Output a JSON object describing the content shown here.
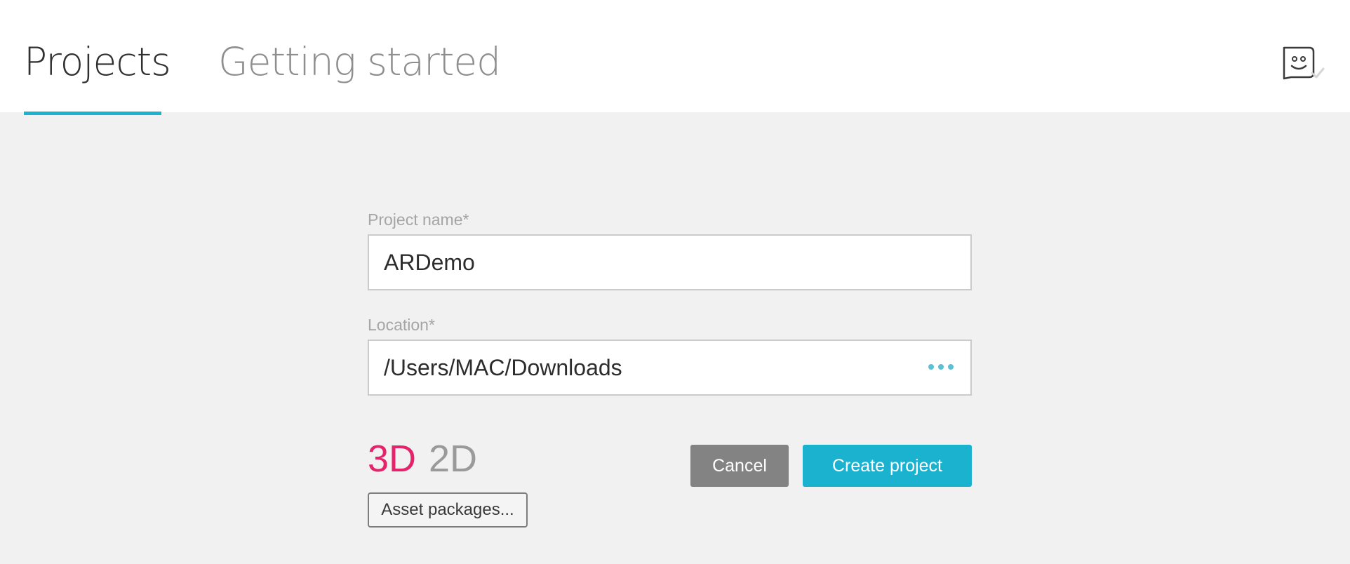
{
  "header": {
    "tabs": [
      {
        "label": "Projects",
        "active": true
      },
      {
        "label": "Getting started",
        "active": false
      }
    ],
    "account_icon": "account-smiley-icon",
    "accent_color": "#1ab2cf"
  },
  "form": {
    "project_name": {
      "label": "Project name*",
      "value": "ARDemo"
    },
    "location": {
      "label": "Location*",
      "value": "/Users/MAC/Downloads",
      "browse_icon": "more-dots-icon"
    },
    "modes": [
      {
        "label": "3D",
        "selected": true,
        "color": "#e5226a"
      },
      {
        "label": "2D",
        "selected": false,
        "color": "#9a9a9a"
      }
    ],
    "asset_packages_label": "Asset packages...",
    "cancel_label": "Cancel",
    "create_label": "Create project"
  }
}
